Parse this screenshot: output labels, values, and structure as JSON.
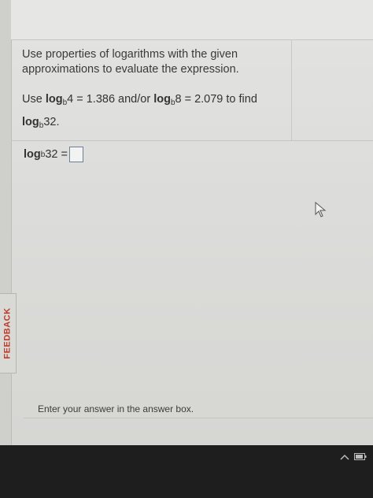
{
  "sidebar": {
    "feedback_label": "FEEDBACK"
  },
  "question": {
    "instructions": "Use properties of logarithms with the given approximations to evaluate the expression.",
    "given": {
      "prefix": "Use ",
      "log1_fn": "log",
      "log1_base": "b",
      "log1_rest": "4 = 1.386 and/or ",
      "log2_fn": "log",
      "log2_base": "b",
      "log2_rest": "8 = 2.079 to find",
      "find_fn": "log",
      "find_base": "b",
      "find_rest": "32."
    }
  },
  "answer": {
    "fn": "log",
    "base": "b",
    "rest": "32 =",
    "value": ""
  },
  "footer": {
    "hint": "Enter your answer in the answer box."
  }
}
